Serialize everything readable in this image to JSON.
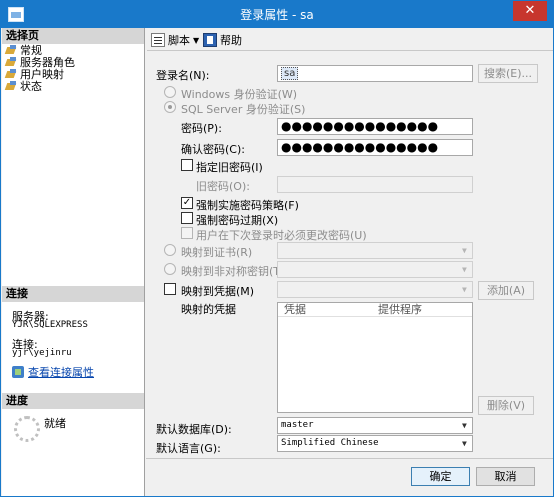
{
  "window": {
    "title": "登录属性 - sa",
    "close_glyph": "✕"
  },
  "sidebar": {
    "select_page_heading": "选择页",
    "items": [
      {
        "label": "常规",
        "icon": "page-icon"
      },
      {
        "label": "服务器角色",
        "icon": "page-icon"
      },
      {
        "label": "用户映射",
        "icon": "page-icon"
      },
      {
        "label": "状态",
        "icon": "page-icon"
      }
    ],
    "connection_heading": "连接",
    "server_label": "服务器:",
    "server_value": "YJR\\SQLEXPRESS",
    "connection_label": "连接:",
    "connection_value": "yjr\\yejinru",
    "view_props_link": "查看连接属性",
    "progress_heading": "进度",
    "progress_status": "就绪"
  },
  "toolbar": {
    "script_label": "脚本",
    "help_label": "帮助"
  },
  "form": {
    "login_name_label": "登录名(N):",
    "login_name_value": "sa",
    "search_button": "搜索(E)...",
    "windows_auth_label": "Windows 身份验证(W)",
    "sql_auth_label": "SQL Server 身份验证(S)",
    "password_label": "密码(P):",
    "password_value": "●●●●●●●●●●●●●●●",
    "confirm_password_label": "确认密码(C):",
    "confirm_password_value": "●●●●●●●●●●●●●●●",
    "specify_old_password_label": "指定旧密码(I)",
    "old_password_label": "旧密码(O):",
    "enforce_policy_label": "强制实施密码策略(F)",
    "enforce_policy_checked": "✓",
    "enforce_expiration_label": "强制密码过期(X)",
    "must_change_label": "用户在下次登录时必须更改密码(U)",
    "map_cert_label": "映射到证书(R)",
    "map_asym_key_label": "映射到非对称密钥(T)",
    "map_credential_label": "映射到凭据(M)",
    "add_button": "添加(A)",
    "mapped_credentials_label": "映射的凭据",
    "grid_col_credential": "凭据",
    "grid_col_provider": "提供程序",
    "remove_button": "删除(V)",
    "default_db_label": "默认数据库(D):",
    "default_db_value": "master",
    "default_lang_label": "默认语言(G):",
    "default_lang_value": "Simplified Chinese",
    "combo_arrow": "▼"
  },
  "footer": {
    "ok_button": "确定",
    "cancel_button": "取消"
  }
}
